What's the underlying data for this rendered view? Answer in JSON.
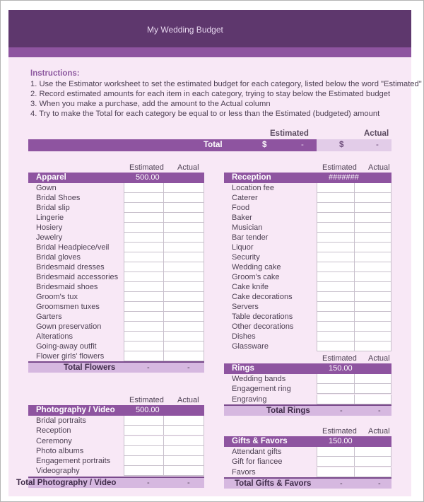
{
  "header": {
    "title": "My Wedding Budget"
  },
  "instructions": {
    "heading": "Instructions:",
    "lines": [
      "1. Use the Estimator worksheet to set the estimated budget for each category, listed below the word \"Estimated\"",
      "2. Record estimated amounts for each item in each category, trying to stay below the Estimated budget",
      "3. When you make a purchase, add the amount to the Actual column",
      "4. Try to make the Total for each category be equal to or less than the Estimated (budgeted) amount"
    ]
  },
  "grand_total": {
    "estimated_header": "Estimated",
    "actual_header": "Actual",
    "label": "Total",
    "estimated_currency": "$",
    "estimated_value": "-",
    "actual_currency": "$",
    "actual_value": "-"
  },
  "column_headers": {
    "estimated": "Estimated",
    "actual": "Actual"
  },
  "sections": {
    "apparel": {
      "name": "Apparel",
      "budget": "500.00",
      "items": [
        "Gown",
        "Bridal Shoes",
        "Bridal slip",
        "Lingerie",
        "Hosiery",
        "Jewelry",
        "Bridal Headpiece/veil",
        "Bridal gloves",
        "Bridesmaid dresses",
        "Bridesmaid accessories",
        "Bridesmaid shoes",
        "Groom's tux",
        "Groomsmen tuxes",
        "Garters",
        "Gown preservation",
        "Alterations",
        "Going-away outfit",
        "Flower girls' flowers"
      ],
      "total_label": "Total Flowers",
      "total_estimated": "-",
      "total_actual": "-"
    },
    "photography": {
      "name": "Photography / Video",
      "budget": "500.00",
      "items": [
        "Bridal portraits",
        "Reception",
        "Ceremony",
        "Photo albums",
        "Engagement portraits",
        "Videography"
      ],
      "total_label": "Total Photography / Video",
      "total_estimated": "-",
      "total_actual": "-"
    },
    "reception": {
      "name": "Reception",
      "budget": "#######",
      "items": [
        "Location fee",
        "Caterer",
        "Food",
        "Baker",
        "Musician",
        "Bar tender",
        "Liquor",
        "Security",
        "Wedding cake",
        "Groom's cake",
        "Cake knife",
        "Cake decorations",
        "Servers",
        "Table decorations",
        "Other decorations",
        "Dishes",
        "Glassware"
      ]
    },
    "rings": {
      "name": "Rings",
      "budget": "150.00",
      "items": [
        "Wedding bands",
        "Engagement ring",
        "Engraving"
      ],
      "total_label": "Total Rings",
      "total_estimated": "-",
      "total_actual": "-"
    },
    "gifts": {
      "name": "Gifts & Favors",
      "budget": "150.00",
      "items": [
        "Attendant gifts",
        "Gift for fiancee",
        "Favors"
      ],
      "total_label": "Total Gifts & Favors",
      "total_estimated": "-",
      "total_actual": "-"
    }
  }
}
